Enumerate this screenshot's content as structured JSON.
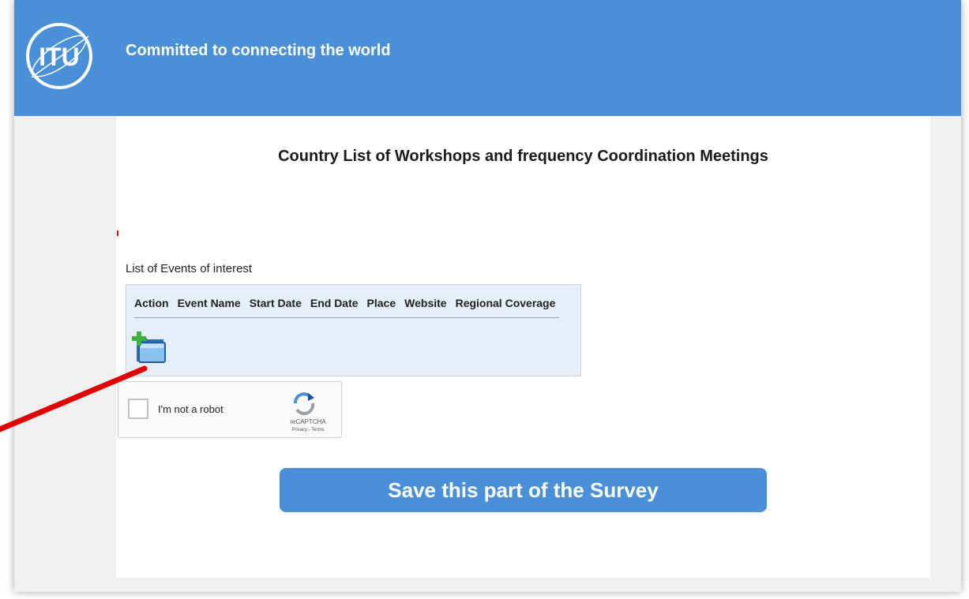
{
  "header": {
    "logo_text": "ITU",
    "tagline": "Committed to connecting the world"
  },
  "page": {
    "title": "Country List of Workshops and frequency Coordination Meetings"
  },
  "events": {
    "label": "List of Events of interest",
    "columns": [
      "Action",
      "Event Name",
      "Start Date",
      "End Date",
      "Place",
      "Website",
      "Regional Coverage"
    ],
    "add_icon": "add-folder-icon"
  },
  "captcha": {
    "label": "I'm not a robot",
    "brand": "reCAPTCHA",
    "links": "Privacy - Terms"
  },
  "actions": {
    "save_label": "Save this part of the Survey"
  },
  "colors": {
    "header": "#4a90d9",
    "button": "#4a90d9",
    "panel": "#e6eef8",
    "annotation_arrow": "#e00000"
  }
}
